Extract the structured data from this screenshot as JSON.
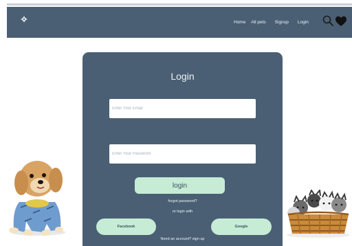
{
  "nav": {
    "links": [
      "Home",
      "All pets",
      "Signup",
      "Login"
    ],
    "icons": [
      "gear-icon",
      "search-icon",
      "heart-icon"
    ]
  },
  "login": {
    "title": "Login",
    "email_placeholder": "Enter Your Email",
    "password_placeholder": "Enter Your Password",
    "login_label": "login",
    "forgot_label": "forgot password?",
    "or_label": "or login with",
    "facebook_label": "Facebook",
    "google_label": "Google",
    "signup_prompt": "Need an account? sign up"
  },
  "colors": {
    "navbar": "#4a5f73",
    "card": "#4a5f73",
    "button": "#c6ecd6"
  }
}
